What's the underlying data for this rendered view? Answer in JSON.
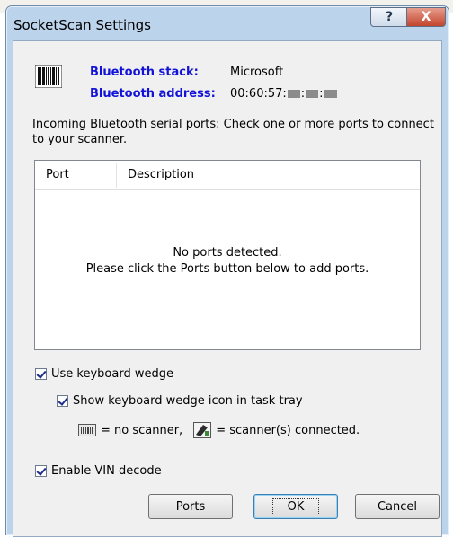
{
  "window": {
    "title": "SocketScan Settings",
    "help_glyph": "?",
    "close_glyph": "X"
  },
  "bluetooth": {
    "stack_label": "Bluetooth stack:",
    "stack_value": "Microsoft",
    "address_label": "Bluetooth address:",
    "address_value": "00:60:57:"
  },
  "instructions": "Incoming Bluetooth serial ports: Check one or more ports to connect to your scanner.",
  "ports_list": {
    "columns": [
      "Port",
      "Description"
    ],
    "empty_line1": "No ports detected.",
    "empty_line2": "Please click the Ports button below to add ports."
  },
  "options": {
    "keyboard_wedge": {
      "label": "Use keyboard wedge",
      "checked": true
    },
    "tray_icon": {
      "label": "Show keyboard wedge icon in task tray",
      "checked": true
    },
    "legend_no_scanner": "= no scanner,",
    "legend_connected": "= scanner(s) connected.",
    "vin_decode": {
      "label": "Enable VIN decode",
      "checked": true
    }
  },
  "buttons": {
    "ports": "Ports",
    "ok": "OK",
    "cancel": "Cancel"
  },
  "icons": {
    "barcode": "barcode-icon",
    "scanner_off": "scanner-disconnected-icon",
    "scanner_on": "scanner-connected-icon"
  },
  "colors": {
    "label_blue": "#1212d8",
    "frame": "#bcd3ec",
    "close": "#c3452e"
  }
}
